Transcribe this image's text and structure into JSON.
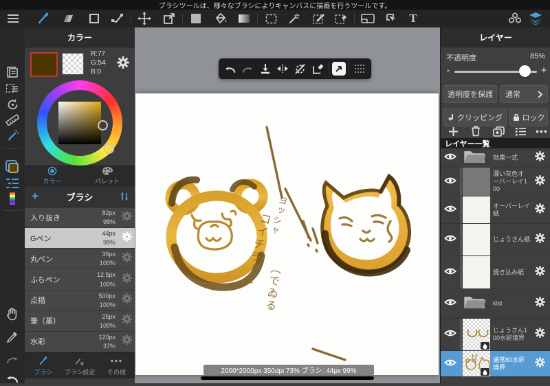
{
  "notification": "ブラシツールは、様々なブラシによりキャンバスに描画を行うツールです。",
  "toolbar": {
    "text_tool_label": "T"
  },
  "color_panel": {
    "title": "カラー",
    "rgb_r": "R:77",
    "rgb_g": "G:54",
    "rgb_b": "B:0",
    "tab_color": "カラー",
    "tab_palette": "パレット",
    "selected_color": "#4d3600"
  },
  "brush_panel": {
    "title": "ブラシ",
    "brushes": [
      {
        "name": "入り抜き",
        "size": "82px",
        "opacity": "98%"
      },
      {
        "name": "Gペン",
        "size": "44px",
        "opacity": "99%"
      },
      {
        "name": "丸ペン",
        "size": "36px",
        "opacity": "100%"
      },
      {
        "name": "ふちペン",
        "size": "12.5px",
        "opacity": "100%"
      },
      {
        "name": "点描",
        "size": "500px",
        "opacity": "100%"
      },
      {
        "name": "筆（墨）",
        "size": "25px",
        "opacity": "100%"
      },
      {
        "name": "水彩",
        "size": "120px",
        "opacity": "37%"
      }
    ],
    "tab_brush": "ブラシ",
    "tab_settings": "ブラシ設定",
    "tab_other": "その他"
  },
  "canvas": {
    "status": "2000*2000px 350dpi 73% ブラシ: 44px 99%",
    "annotations": {
      "a1": "ヨッシャ",
      "a2": "コイチラー!!",
      "a3": "（でゐる"
    }
  },
  "layers_panel": {
    "title": "レイヤー",
    "opacity_label": "不透明度",
    "opacity_value": "85%",
    "minus": "-",
    "plus": "+",
    "protect_label": "透明度を保護",
    "blend_label": "通常",
    "clipping_label": "クリッピング",
    "lock_label": "ロック",
    "list_title": "レイヤー一覧",
    "selected_row_color": "#579bd5",
    "layers": [
      {
        "name": "効果一式"
      },
      {
        "name": "濃い灰色オーバーレイ100"
      },
      {
        "name": "オーバーレイ紙"
      },
      {
        "name": "じょうさん紙"
      },
      {
        "name": "焼き込み紙"
      },
      {
        "name": "klst"
      },
      {
        "name": "じょうさん100水彩境界"
      },
      {
        "name": "通常80水彩境界"
      }
    ]
  }
}
